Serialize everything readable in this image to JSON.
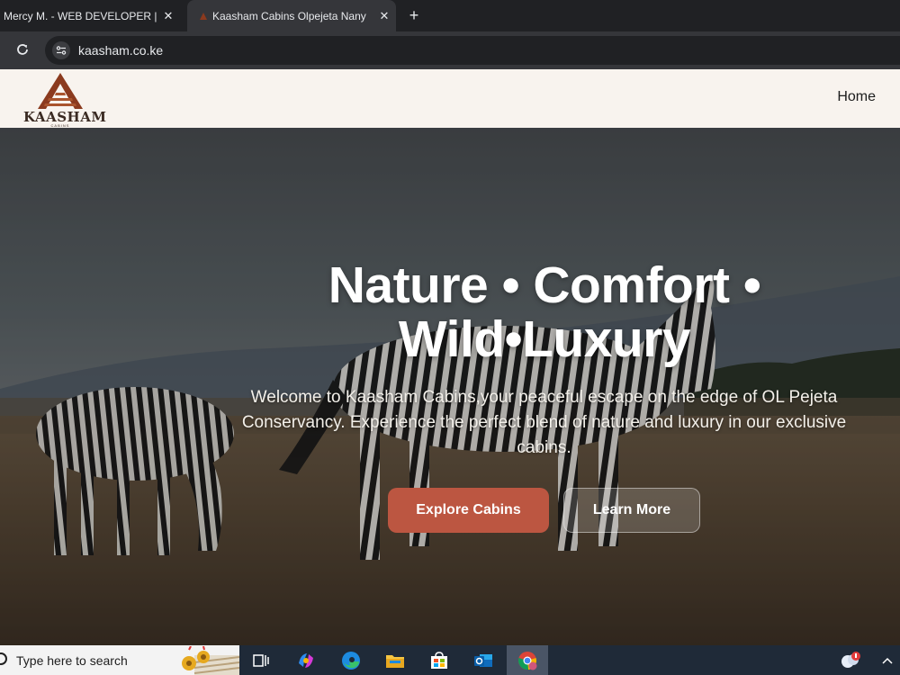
{
  "browser": {
    "tabs": [
      {
        "title": "Mercy M. - WEB DEVELOPER | P",
        "active": false
      },
      {
        "title": "Kaasham Cabins Olpejeta Nany",
        "active": true
      }
    ],
    "new_tab_label": "+",
    "close_label": "✕",
    "address": "kaasham.co.ke"
  },
  "site": {
    "logo_text": "KAASHAM",
    "logo_subtext": "CABINS",
    "nav": {
      "home": "Home"
    },
    "hero": {
      "headline_line1": "Nature • Comfort •",
      "headline_line2": "Wild•Luxury",
      "subtext": "Welcome to Kaasham Cabins,your peaceful escape on the edge of OL Pejeta Conservancy. Experience the perfect blend of nature and luxury in our exclusive cabins.",
      "primary_button": "Explore Cabins",
      "secondary_button": "Learn More"
    },
    "colors": {
      "nav_bg": "#f8f3ee",
      "primary": "#bc5641",
      "logo": "#8b3a1e"
    }
  },
  "taskbar": {
    "search_placeholder": "Type here to search",
    "icons": [
      "task-view-icon",
      "copilot-icon",
      "edge-icon",
      "file-explorer-icon",
      "store-icon",
      "outlook-icon",
      "chrome-icon",
      "weather-icon"
    ]
  }
}
